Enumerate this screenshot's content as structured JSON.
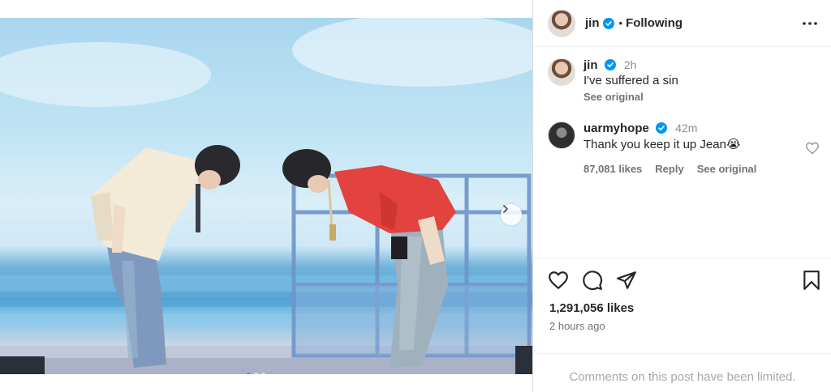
{
  "post": {
    "author": "jin",
    "follow_status": "Following",
    "separator": "•",
    "carousel_dots": 3,
    "active_dot": 0
  },
  "caption": {
    "username": "jin",
    "time": "2h",
    "text": "I've suffered a sin",
    "see_original": "See original"
  },
  "comments": [
    {
      "username": "uarmyhope",
      "time": "42m",
      "text": "Thank you keep it up Jean😭",
      "likes": "87,081 likes",
      "reply": "Reply",
      "see_original": "See original"
    }
  ],
  "stats": {
    "likes": "1,291,056 likes",
    "posted": "2 hours ago"
  },
  "footer": {
    "notice": "Comments on this post have been limited."
  },
  "icons": [
    "verified-badge-icon",
    "more-options-icon",
    "heart-icon",
    "comment-icon",
    "share-icon",
    "bookmark-icon",
    "chevron-right-icon"
  ],
  "colors": {
    "verified": "#0095f6",
    "text": "#262626",
    "muted": "#737373",
    "divider": "#dbdbdb"
  }
}
